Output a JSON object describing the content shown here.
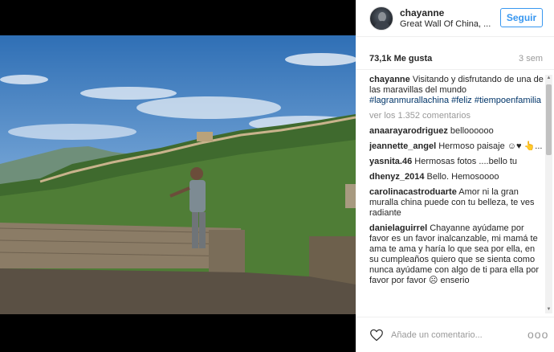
{
  "post": {
    "username": "chayanne",
    "location": "Great Wall Of China, ...",
    "follow_label": "Seguir",
    "likes": "73,1k Me gusta",
    "age": "3 sem"
  },
  "caption": {
    "username": "chayanne",
    "text": "Visitando y disfrutando de una de las maravillas del mundo",
    "hashtags": [
      "#lagranmurallachina",
      "#feliz",
      "#tiempoenfamilia"
    ]
  },
  "view_comments": "ver los 1.352 comentarios",
  "comments": [
    {
      "user": "anaarayarodriguez",
      "text": "belloooooo"
    },
    {
      "user": "jeannette_angel",
      "text": "Hermoso paisaje ☺♥ 👆..."
    },
    {
      "user": "yasnita.46",
      "text": "Hermosas fotos ....bello tu"
    },
    {
      "user": "dhenyz_2014",
      "text": "Bello. Hemosoooo"
    },
    {
      "user": "carolinacastroduarte",
      "text": "Amor ni la gran muralla china puede con tu belleza, te ves radiante"
    },
    {
      "user": "danielaguirrel",
      "text": "Chayanne ayúdame por favor es un favor inalcanzable, mi mamá te ama te ama y haría lo que sea por ella, en su cumpleaños quiero que se sienta como nunca ayúdame con algo de ti para ella por favor por favor ☹ enserio"
    }
  ],
  "footer": {
    "placeholder": "Añade un comentario...",
    "more_label": "ooo",
    "heart_icon": "heart-outline-icon"
  },
  "colors": {
    "link_blue": "#3897f0",
    "hashtag": "#003569",
    "muted": "#999999"
  }
}
